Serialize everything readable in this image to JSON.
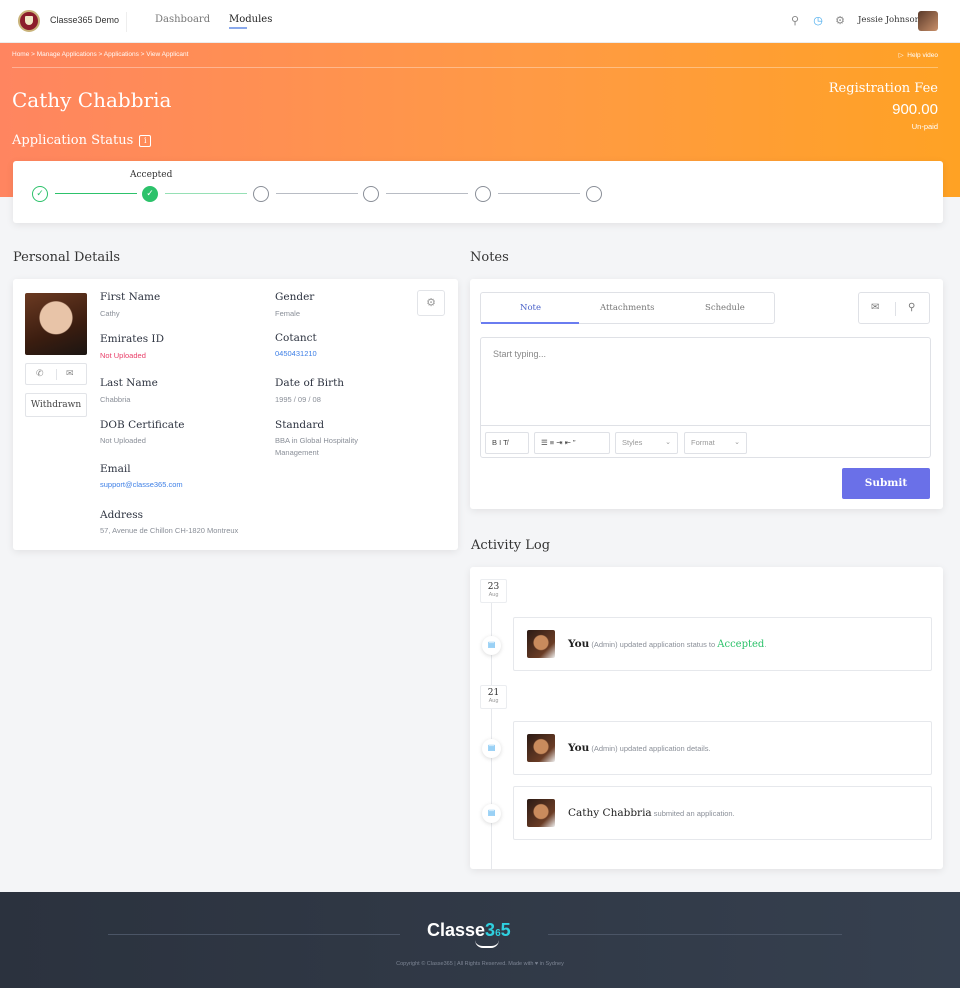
{
  "nav": {
    "brand": "Classe365 Demo",
    "links": [
      "Dashboard",
      "Modules"
    ],
    "user_name": "Jessie Johnson",
    "icons": [
      "search-icon",
      "notification-icon",
      "settings-icon"
    ]
  },
  "header": {
    "breadcrumb": "Home > Manage Applications > Applications > View Applicant",
    "help_video": "Help video",
    "applicant_name": "Cathy Chabbria",
    "application_status_label": "Application Status",
    "info_icon": "i",
    "fee_label": "Registration Fee",
    "fee_amount": "900.00",
    "fee_status": "Un-paid"
  },
  "stepper": {
    "current_label": "Accepted",
    "steps": [
      "done",
      "active",
      "pending",
      "pending",
      "pending",
      "pending"
    ]
  },
  "personal": {
    "title": "Personal Details",
    "withdrawn_button": "Withdrawn",
    "fields": {
      "first_name": {
        "label": "First Name",
        "value": "Cathy"
      },
      "gender": {
        "label": "Gender",
        "value": "Female"
      },
      "emirates_id": {
        "label": "Emirates ID",
        "value": "Not Uploaded"
      },
      "contact": {
        "label": "Cotanct",
        "value": "0450431210"
      },
      "last_name": {
        "label": "Last Name",
        "value": "Chabbria"
      },
      "dob": {
        "label": "Date of Birth",
        "value": "1995 / 09 / 08"
      },
      "dob_cert": {
        "label": "DOB Certificate",
        "value": "Not Uploaded"
      },
      "standard": {
        "label": "Standard",
        "value": "BBA in Global Hospitality Management"
      },
      "email": {
        "label": "Email",
        "value": "support@classe365.com"
      },
      "address": {
        "label": "Address",
        "value": "57, Avenue de Chillon CH-1820 Montreux"
      }
    }
  },
  "notes": {
    "title": "Notes",
    "tabs": [
      "Note",
      "Attachments",
      "Schedule"
    ],
    "placeholder": "Start typing...",
    "toolbar": {
      "format_basic": "B  I  T̸",
      "format_lists": "☰  ≡  ⇥  ⇤  ”",
      "styles": "Styles",
      "format": "Format"
    },
    "submit_label": "Submit"
  },
  "activity": {
    "title": "Activity Log",
    "groups": [
      {
        "day": "23",
        "month": "Aug"
      },
      {
        "day": "21",
        "month": "Aug"
      }
    ],
    "entries": [
      {
        "who": "You",
        "rest": "(Admin) updated application status to ",
        "status": "Accepted",
        "tail": "."
      },
      {
        "who": "You",
        "rest": "(Admin) updated application details."
      },
      {
        "who": "Cathy Chabbria",
        "rest": "submited an application."
      }
    ]
  },
  "footer": {
    "logo_main": "Classe",
    "logo_accent": "3",
    "logo_accent2": "5",
    "logo_mid": "6",
    "copyright": "Copyright © Classe365 | All Rights Reserved. Made with ♥ in Sydney"
  }
}
